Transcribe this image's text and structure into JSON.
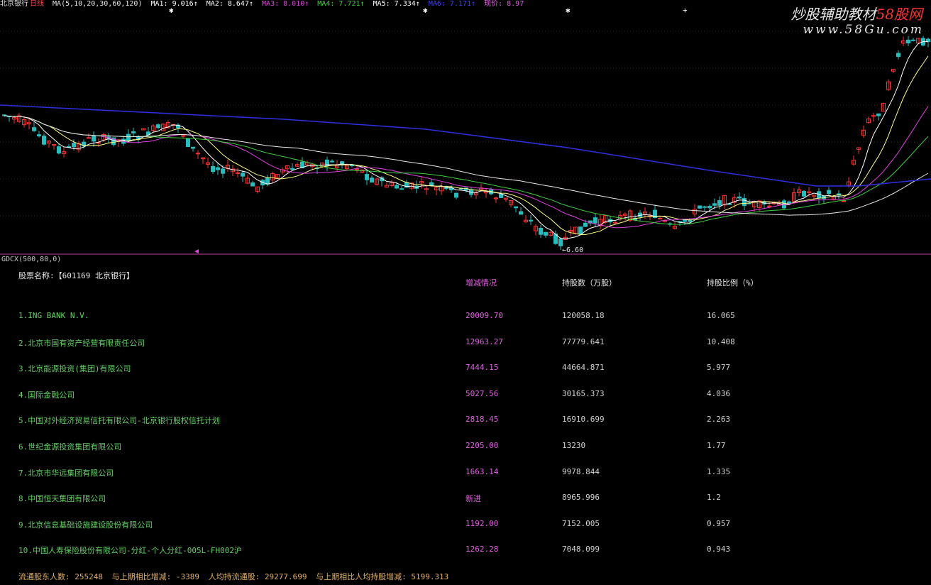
{
  "legend": {
    "title": "北京银行",
    "period": "日线",
    "ma_spec": "MA(5,10,20,30,60,120)",
    "items": [
      {
        "label": "MA1: 9.016↑",
        "color": "#ffffff"
      },
      {
        "label": "MA2: 8.647↑",
        "color": "#ffffff"
      },
      {
        "label": "MA3: 8.010↑",
        "color": "#e040e0"
      },
      {
        "label": "MA4: 7.721↑",
        "color": "#40d040"
      },
      {
        "label": "MA5: 7.334↑",
        "color": "#ffffff"
      },
      {
        "label": "MA6: 7.171↑",
        "color": "#4040ff"
      },
      {
        "label": "现价: 8.97",
        "color": "#e060e0"
      }
    ]
  },
  "watermark": {
    "line1_a": "炒股辅助教材",
    "line1_b": "58股网",
    "line2": "www.58Gu.com"
  },
  "chart_data": {
    "type": "candlestick",
    "low_label": "6.60",
    "colors": {
      "up": "#ff3030",
      "down": "#20c0c0",
      "ma1": "#ffffff",
      "ma2": "#ffff80",
      "ma3": "#e040e0",
      "ma4": "#40d040",
      "ma5": "#e8e8e8",
      "ma6": "#3030e0"
    }
  },
  "indicator": {
    "label": "GDCX(500,80,0)"
  },
  "table": {
    "stock_label": "股票名称:【601169 北京银行】",
    "headers": [
      "增减情况",
      "持股数（万股）",
      "持股比例（%）"
    ],
    "rows": [
      {
        "name": "1.ING BANK N.V.",
        "change": "20009.70",
        "shares": "120058.18",
        "ratio": "16.065"
      },
      {
        "name": "2.北京市国有资产经营有限责任公司",
        "change": "12963.27",
        "shares": "77779.641",
        "ratio": "10.408"
      },
      {
        "name": "3.北京能源投资(集团)有限公司",
        "change": "7444.15",
        "shares": "44664.871",
        "ratio": "5.977"
      },
      {
        "name": "4.国际金融公司",
        "change": "5027.56",
        "shares": "30165.373",
        "ratio": "4.036"
      },
      {
        "name": "5.中国对外经济贸易信托有限公司-北京银行股权信托计划",
        "change": "2818.45",
        "shares": "16910.699",
        "ratio": "2.263"
      },
      {
        "name": "6.世纪金源投资集团有限公司",
        "change": "2205.00",
        "shares": "13230",
        "ratio": "1.77"
      },
      {
        "name": "7.北京市华远集团有限公司",
        "change": "1663.14",
        "shares": "9978.844",
        "ratio": "1.335"
      },
      {
        "name": "8.中国恒天集团有限公司",
        "change": "新进",
        "shares": "8965.996",
        "ratio": "1.2"
      },
      {
        "name": "9.北京信息基础设施建设股份有限公司",
        "change": "1192.00",
        "shares": "7152.005",
        "ratio": "0.957"
      },
      {
        "name": "10.中国人寿保险股份有限公司-分红-个人分红-005L-FH002沪",
        "change": "1262.28",
        "shares": "7048.099",
        "ratio": "0.943"
      }
    ]
  },
  "footer": {
    "holders": "流通股东人数: 255248",
    "holders_change": "与上期相比增减: -3389",
    "avg_shares": "人均持流通股: 29277.699",
    "avg_change": "与上期相比人均持股增减: 5199.313"
  }
}
